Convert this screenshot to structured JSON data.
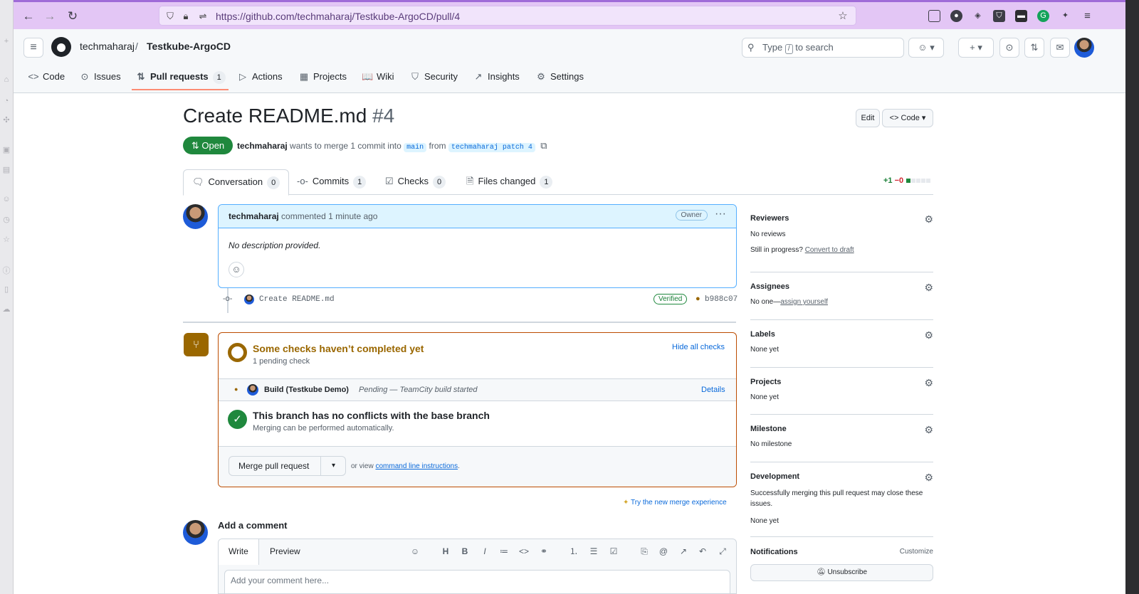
{
  "browser": {
    "url": "https://github.com/techmaharaj/Testkube-ArgoCD/pull/4"
  },
  "header": {
    "owner": "techmaharaj",
    "separator": "/",
    "repo": "Testkube-ArgoCD",
    "search_prefix": "Type",
    "search_key": "/",
    "search_suffix": "to search",
    "plus_label": "+ ▾"
  },
  "nav": {
    "items": [
      {
        "label": "Code",
        "icon": "code-icon",
        "glyph": "<>"
      },
      {
        "label": "Issues",
        "icon": "issue-icon",
        "glyph": "⊙"
      },
      {
        "label": "Pull requests",
        "icon": "pull-request-icon",
        "glyph": "⇅",
        "count": "1"
      },
      {
        "label": "Actions",
        "icon": "play-icon",
        "glyph": "▷"
      },
      {
        "label": "Projects",
        "icon": "table-icon",
        "glyph": "▦"
      },
      {
        "label": "Wiki",
        "icon": "book-icon",
        "glyph": "📖"
      },
      {
        "label": "Security",
        "icon": "shield-icon",
        "glyph": "⛉"
      },
      {
        "label": "Insights",
        "icon": "graph-icon",
        "glyph": "↗"
      },
      {
        "label": "Settings",
        "icon": "gear-icon",
        "glyph": "⚙"
      }
    ]
  },
  "pr": {
    "title": "Create README.md",
    "number": "#4",
    "edit_label": "Edit",
    "code_label": "Code",
    "status": "Open",
    "author": "techmaharaj",
    "merge_text": "wants to merge 1 commit into",
    "base_branch": "main",
    "from_text": "from",
    "head_branch": "techmaharaj patch 4",
    "diff_add": "+1",
    "diff_del": "−0"
  },
  "tabs": [
    {
      "label": "Conversation",
      "count": "0",
      "icon": "comment-icon",
      "glyph": "🗨"
    },
    {
      "label": "Commits",
      "count": "1",
      "icon": "commit-icon",
      "glyph": "-o-"
    },
    {
      "label": "Checks",
      "count": "0",
      "icon": "checklist-icon",
      "glyph": "☑"
    },
    {
      "label": "Files changed",
      "count": "1",
      "icon": "file-diff-icon",
      "glyph": "🗎"
    }
  ],
  "comment": {
    "author": "techmaharaj",
    "action": "commented",
    "time": "1 minute ago",
    "badge": "Owner",
    "body": "No description provided."
  },
  "commit": {
    "message": "Create README.md",
    "verified": "Verified",
    "sha": "b988c07"
  },
  "checks": {
    "title": "Some checks haven’t completed yet",
    "subtitle": "1 pending check",
    "hide_label": "Hide all checks",
    "check_name": "Build (Testkube Demo)",
    "check_status": "Pending — TeamCity build started",
    "details_label": "Details",
    "conflict_title": "This branch has no conflicts with the base branch",
    "conflict_sub": "Merging can be performed automatically.",
    "merge_button": "Merge pull request",
    "or_view": "or view",
    "cli_link": "command line instructions",
    "period": ".",
    "try_new": "Try the new merge experience"
  },
  "add_comment": {
    "title": "Add a comment",
    "write": "Write",
    "preview": "Preview",
    "placeholder": "Add your comment here..."
  },
  "sidebar": {
    "reviewers_title": "Reviewers",
    "reviewers_value": "No reviews",
    "in_progress": "Still in progress?",
    "convert": "Convert to draft",
    "assignees_title": "Assignees",
    "assignees_value": "No one—",
    "assign_yourself": "assign yourself",
    "labels_title": "Labels",
    "labels_value": "None yet",
    "projects_title": "Projects",
    "projects_value": "None yet",
    "milestone_title": "Milestone",
    "milestone_value": "No milestone",
    "development_title": "Development",
    "development_text": "Successfully merging this pull request may close these issues.",
    "development_value": "None yet",
    "notifications_title": "Notifications",
    "customize": "Customize",
    "unsubscribe": "Unsubscribe"
  },
  "colors": {
    "open_green": "#1f883d",
    "pending_brown": "#9a6700",
    "link_blue": "#0969da",
    "browser_purple": "#e3c6f5"
  }
}
